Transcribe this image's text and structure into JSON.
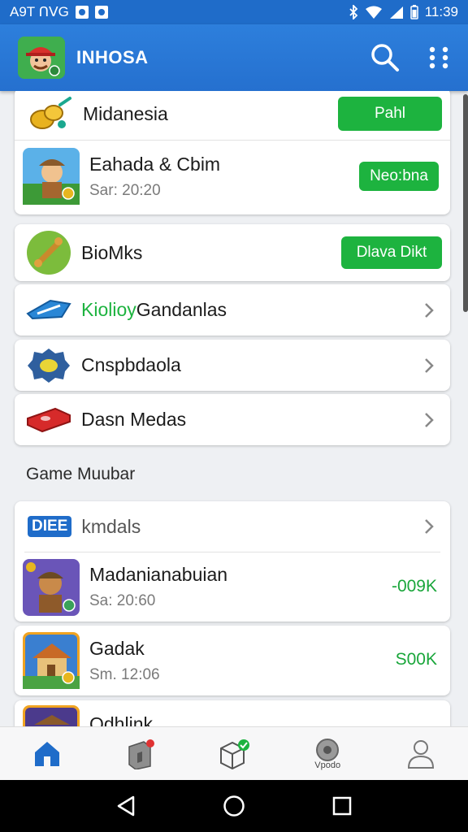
{
  "status_bar": {
    "left_text": "A9T ᑎᐯG",
    "time": "11:39"
  },
  "app_bar": {
    "title": "INHOSA",
    "logo_icon": "character-logo",
    "search_icon": "search-icon",
    "menu_icon": "grid-dots-icon",
    "color": "#2570cf"
  },
  "list_top": [
    {
      "title": "Midanesia",
      "button": "Pahl",
      "icon": "coins-icon"
    },
    {
      "title": "Eahada & Cbim",
      "subtitle": "Sar: 20:20",
      "button": "Neo:bna",
      "icon": "adventurer-icon"
    },
    {
      "title": "BioMks",
      "button": "Dlava Dikt",
      "icon": "bone-icon"
    }
  ],
  "list_nav": [
    {
      "prefix": "Kiolioy",
      "title": "Gandanlas",
      "icon": "blue-plane-icon"
    },
    {
      "title": "Cnspbdaola",
      "icon": "gear-gem-icon"
    },
    {
      "title": "Dasn Medas",
      "icon": "red-bar-icon"
    }
  ],
  "section": {
    "title": "Game Muubar"
  },
  "game_list": {
    "header": {
      "badge": "DIEE",
      "title": "kmdals"
    },
    "items": [
      {
        "title": "Madanianabuian",
        "subtitle": "Sa: 20:60",
        "price": "-009K",
        "icon": "warrior-icon"
      },
      {
        "title": "Gadak",
        "subtitle": "Sm. 12:06",
        "price": "S00K",
        "icon": "house-icon"
      },
      {
        "title": "Qdhlink",
        "icon": "ship-icon"
      }
    ]
  },
  "bottom_nav": [
    {
      "name": "home",
      "icon": "home-icon",
      "label": ""
    },
    {
      "name": "store",
      "icon": "store-icon",
      "label": ""
    },
    {
      "name": "box",
      "icon": "box-check-icon",
      "label": ""
    },
    {
      "name": "vpodo",
      "icon": "disc-icon",
      "label": "Vpodo"
    },
    {
      "name": "profile",
      "icon": "person-icon",
      "label": ""
    }
  ],
  "accent": "#1db33f"
}
